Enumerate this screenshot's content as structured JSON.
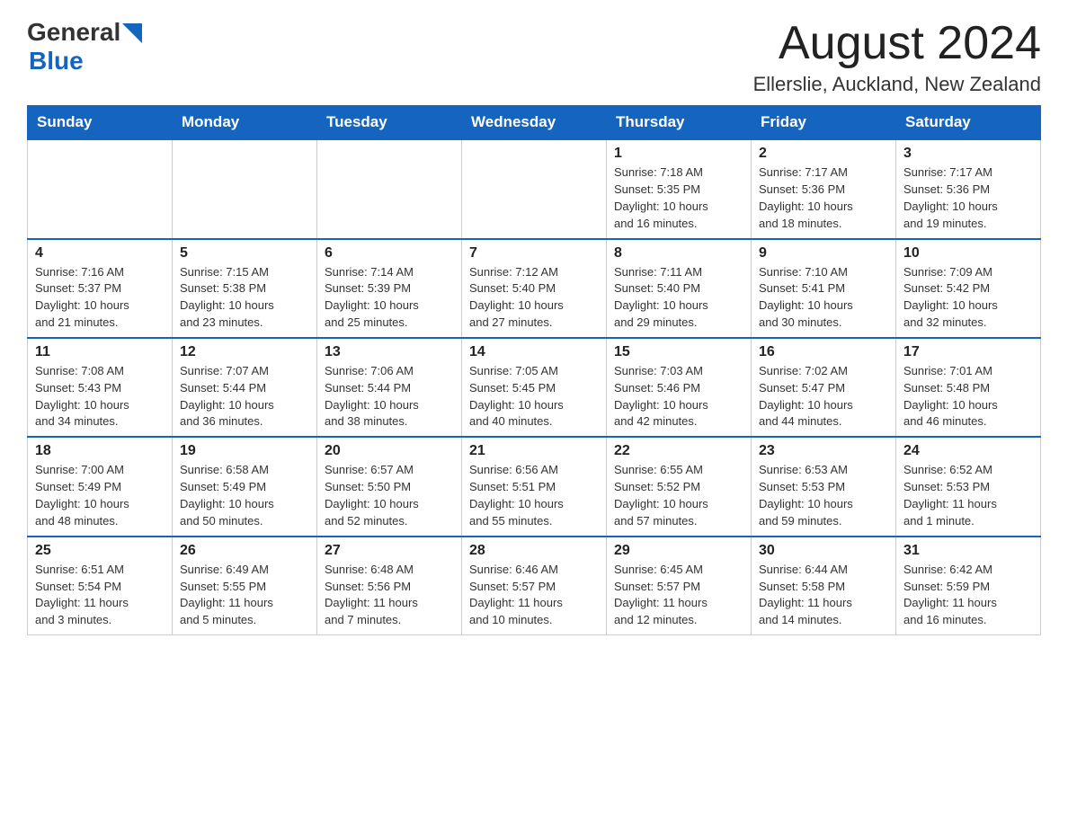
{
  "header": {
    "title": "August 2024",
    "location": "Ellerslie, Auckland, New Zealand",
    "logo_general": "General",
    "logo_blue": "Blue"
  },
  "days_of_week": [
    "Sunday",
    "Monday",
    "Tuesday",
    "Wednesday",
    "Thursday",
    "Friday",
    "Saturday"
  ],
  "weeks": [
    [
      {
        "day": "",
        "info": ""
      },
      {
        "day": "",
        "info": ""
      },
      {
        "day": "",
        "info": ""
      },
      {
        "day": "",
        "info": ""
      },
      {
        "day": "1",
        "info": "Sunrise: 7:18 AM\nSunset: 5:35 PM\nDaylight: 10 hours\nand 16 minutes."
      },
      {
        "day": "2",
        "info": "Sunrise: 7:17 AM\nSunset: 5:36 PM\nDaylight: 10 hours\nand 18 minutes."
      },
      {
        "day": "3",
        "info": "Sunrise: 7:17 AM\nSunset: 5:36 PM\nDaylight: 10 hours\nand 19 minutes."
      }
    ],
    [
      {
        "day": "4",
        "info": "Sunrise: 7:16 AM\nSunset: 5:37 PM\nDaylight: 10 hours\nand 21 minutes."
      },
      {
        "day": "5",
        "info": "Sunrise: 7:15 AM\nSunset: 5:38 PM\nDaylight: 10 hours\nand 23 minutes."
      },
      {
        "day": "6",
        "info": "Sunrise: 7:14 AM\nSunset: 5:39 PM\nDaylight: 10 hours\nand 25 minutes."
      },
      {
        "day": "7",
        "info": "Sunrise: 7:12 AM\nSunset: 5:40 PM\nDaylight: 10 hours\nand 27 minutes."
      },
      {
        "day": "8",
        "info": "Sunrise: 7:11 AM\nSunset: 5:40 PM\nDaylight: 10 hours\nand 29 minutes."
      },
      {
        "day": "9",
        "info": "Sunrise: 7:10 AM\nSunset: 5:41 PM\nDaylight: 10 hours\nand 30 minutes."
      },
      {
        "day": "10",
        "info": "Sunrise: 7:09 AM\nSunset: 5:42 PM\nDaylight: 10 hours\nand 32 minutes."
      }
    ],
    [
      {
        "day": "11",
        "info": "Sunrise: 7:08 AM\nSunset: 5:43 PM\nDaylight: 10 hours\nand 34 minutes."
      },
      {
        "day": "12",
        "info": "Sunrise: 7:07 AM\nSunset: 5:44 PM\nDaylight: 10 hours\nand 36 minutes."
      },
      {
        "day": "13",
        "info": "Sunrise: 7:06 AM\nSunset: 5:44 PM\nDaylight: 10 hours\nand 38 minutes."
      },
      {
        "day": "14",
        "info": "Sunrise: 7:05 AM\nSunset: 5:45 PM\nDaylight: 10 hours\nand 40 minutes."
      },
      {
        "day": "15",
        "info": "Sunrise: 7:03 AM\nSunset: 5:46 PM\nDaylight: 10 hours\nand 42 minutes."
      },
      {
        "day": "16",
        "info": "Sunrise: 7:02 AM\nSunset: 5:47 PM\nDaylight: 10 hours\nand 44 minutes."
      },
      {
        "day": "17",
        "info": "Sunrise: 7:01 AM\nSunset: 5:48 PM\nDaylight: 10 hours\nand 46 minutes."
      }
    ],
    [
      {
        "day": "18",
        "info": "Sunrise: 7:00 AM\nSunset: 5:49 PM\nDaylight: 10 hours\nand 48 minutes."
      },
      {
        "day": "19",
        "info": "Sunrise: 6:58 AM\nSunset: 5:49 PM\nDaylight: 10 hours\nand 50 minutes."
      },
      {
        "day": "20",
        "info": "Sunrise: 6:57 AM\nSunset: 5:50 PM\nDaylight: 10 hours\nand 52 minutes."
      },
      {
        "day": "21",
        "info": "Sunrise: 6:56 AM\nSunset: 5:51 PM\nDaylight: 10 hours\nand 55 minutes."
      },
      {
        "day": "22",
        "info": "Sunrise: 6:55 AM\nSunset: 5:52 PM\nDaylight: 10 hours\nand 57 minutes."
      },
      {
        "day": "23",
        "info": "Sunrise: 6:53 AM\nSunset: 5:53 PM\nDaylight: 10 hours\nand 59 minutes."
      },
      {
        "day": "24",
        "info": "Sunrise: 6:52 AM\nSunset: 5:53 PM\nDaylight: 11 hours\nand 1 minute."
      }
    ],
    [
      {
        "day": "25",
        "info": "Sunrise: 6:51 AM\nSunset: 5:54 PM\nDaylight: 11 hours\nand 3 minutes."
      },
      {
        "day": "26",
        "info": "Sunrise: 6:49 AM\nSunset: 5:55 PM\nDaylight: 11 hours\nand 5 minutes."
      },
      {
        "day": "27",
        "info": "Sunrise: 6:48 AM\nSunset: 5:56 PM\nDaylight: 11 hours\nand 7 minutes."
      },
      {
        "day": "28",
        "info": "Sunrise: 6:46 AM\nSunset: 5:57 PM\nDaylight: 11 hours\nand 10 minutes."
      },
      {
        "day": "29",
        "info": "Sunrise: 6:45 AM\nSunset: 5:57 PM\nDaylight: 11 hours\nand 12 minutes."
      },
      {
        "day": "30",
        "info": "Sunrise: 6:44 AM\nSunset: 5:58 PM\nDaylight: 11 hours\nand 14 minutes."
      },
      {
        "day": "31",
        "info": "Sunrise: 6:42 AM\nSunset: 5:59 PM\nDaylight: 11 hours\nand 16 minutes."
      }
    ]
  ],
  "colors": {
    "header_bg": "#1565C0",
    "header_text": "#ffffff",
    "border": "#1565C0",
    "body_text": "#333333"
  }
}
